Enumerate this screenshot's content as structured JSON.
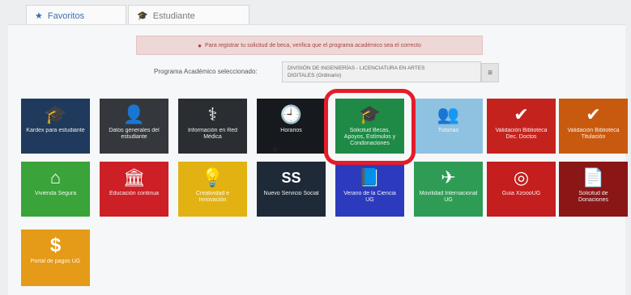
{
  "tabs": {
    "favoritos": "Favoritos",
    "estudiante": "Estudiante"
  },
  "alert": {
    "text": "Para registrar tu solicitud de beca, verifica que el programa académico sea el correcto"
  },
  "program": {
    "label": "Programa Académico seleccionado:",
    "line1": "DIVISIÓN DE INGENIERÍAS - LICENCIATURA EN ARTES",
    "line2": "DIGITALES (Ordinario)"
  },
  "tiles": [
    {
      "label": "Kardex para estudiante",
      "icon": "graduation-cap-icon",
      "glyph": "🎓",
      "color": "#1f3a5c"
    },
    {
      "label": "Datos generales del estudiante",
      "icon": "user-icon",
      "glyph": "👤",
      "color": "#34373b"
    },
    {
      "label": "Información en Red Médica",
      "icon": "doctor-icon",
      "glyph": "⚕",
      "color": "#2a2d31"
    },
    {
      "label": "Horarios",
      "icon": "clock-icon",
      "glyph": "🕘",
      "color": "#16191d"
    },
    {
      "label": "Solicitud Becas, Apoyos, Estímulos y Condonaciones",
      "icon": "graduation-cap-icon",
      "glyph": "🎓",
      "color": "#1e8a45"
    },
    {
      "label": "Tutorías",
      "icon": "people-icon",
      "glyph": "👥",
      "color": "#8fc1e0"
    },
    {
      "label": "Validación Biblioteca Dec. Doctos",
      "icon": "check-circle-icon",
      "glyph": "✔",
      "color": "#c4231d"
    },
    {
      "label": "Validación Biblioteca Titulación",
      "icon": "check-circle-icon",
      "glyph": "✔",
      "color": "#c85a10"
    },
    {
      "label": "Vivienda Segura",
      "icon": "home-icon",
      "glyph": "⌂",
      "color": "#3aa33a"
    },
    {
      "label": "Educación continua",
      "icon": "institution-icon",
      "glyph": "🏛",
      "color": "#cc1f26"
    },
    {
      "label": "Creatividad e Innovación",
      "icon": "lightbulb-icon",
      "glyph": "💡",
      "color": "#e2b212"
    },
    {
      "label": "Nuevo Servicio Social",
      "icon": "servicio-social-icon",
      "glyph": "SS",
      "color": "#1e2a38"
    },
    {
      "label": "Verano de la Ciencia UG",
      "icon": "book-icon",
      "glyph": "📘",
      "color": "#2c3bbd"
    },
    {
      "label": "Movilidad Internacional UG",
      "icon": "plane-icon",
      "glyph": "✈",
      "color": "#2f9c55"
    },
    {
      "label": "Guía XzoooUG",
      "icon": "compass-icon",
      "glyph": "◎",
      "color": "#c41e1e"
    },
    {
      "label": "Solicitud de Donaciones",
      "icon": "document-icon",
      "glyph": "📄",
      "color": "#8a1616"
    },
    {
      "label": "Portal de pagos UG",
      "icon": "dollar-icon",
      "glyph": "$",
      "color": "#e59a18"
    }
  ]
}
